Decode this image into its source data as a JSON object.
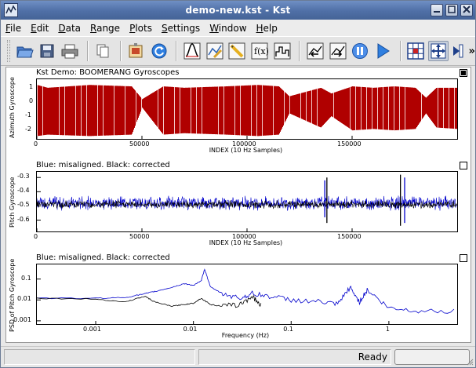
{
  "window": {
    "title": "demo-new.kst - Kst",
    "controls": [
      "minimize-icon",
      "maximize-icon",
      "close-icon"
    ],
    "titlebar_color": "#4f6fa6"
  },
  "menu": [
    {
      "label": "File",
      "mnemonic": "F"
    },
    {
      "label": "Edit",
      "mnemonic": "E"
    },
    {
      "label": "Data",
      "mnemonic": "D"
    },
    {
      "label": "Range",
      "mnemonic": "R"
    },
    {
      "label": "Plots",
      "mnemonic": "P"
    },
    {
      "label": "Settings",
      "mnemonic": "S"
    },
    {
      "label": "Window",
      "mnemonic": "W"
    },
    {
      "label": "Help",
      "mnemonic": "H"
    }
  ],
  "toolbar": {
    "icons": [
      "open-icon",
      "save-icon",
      "print-icon",
      "copy-icon",
      "export-image-icon",
      "reload-icon",
      "data-wizard-icon",
      "edit-curve-icon",
      "edit-plugin-icon",
      "edit-equation-icon",
      "edit-histogram-icon",
      "zoom-back-icon",
      "zoom-forward-icon",
      "pause-icon",
      "play-icon",
      "layout-grid-icon",
      "zoom-mode-icon",
      "more-icon"
    ],
    "active": "zoom-mode-icon",
    "overflow_label": "»"
  },
  "plots": [
    {
      "title": "Kst Demo: BOOMERANG Gyroscopes",
      "ylabel": "Azimuth Gyroscope",
      "xlabel": "INDEX (10 Hz Samples)",
      "y_ticks": [
        "1",
        "0",
        "-1",
        "-2"
      ],
      "x_ticks": [
        "0",
        "50000",
        "100000",
        "150000"
      ],
      "selected": true
    },
    {
      "title": "Blue: misaligned.  Black: corrected",
      "ylabel": "Pitch Gyroscope",
      "xlabel": "INDEX (10 Hz Samples)",
      "y_ticks": [
        "-0.3",
        "-0.4",
        "-0.5",
        "-0.6"
      ],
      "x_ticks": [
        "0",
        "50000",
        "100000",
        "150000"
      ],
      "selected": false
    },
    {
      "title": "Blue: misaligned.  Black: corrected",
      "ylabel": "PSD of Pitch Gyroscope",
      "xlabel": "Frequency (Hz)",
      "y_ticks": [
        "0.1",
        "0.01",
        "0.001"
      ],
      "x_ticks": [
        "0.001",
        "0.01",
        "0.1",
        "1"
      ],
      "selected": false
    }
  ],
  "chart_data": [
    {
      "type": "line",
      "title": "Kst Demo: BOOMERANG Gyroscopes",
      "xlabel": "INDEX (10 Hz Samples)",
      "ylabel": "Azimuth Gyroscope",
      "xlim": [
        0,
        200000
      ],
      "ylim": [
        -2.6,
        1.6
      ],
      "series": [
        {
          "name": "Azimuth",
          "color": "#b00000",
          "x": [
            0,
            5000,
            25000,
            45000,
            50000,
            60000,
            70000,
            90000,
            105000,
            115000,
            120000,
            135000,
            140000,
            150000,
            160000,
            170000,
            180000,
            185000,
            190000,
            200000
          ],
          "y_min": [
            -2.4,
            -2.3,
            -2.4,
            -2.3,
            -0.4,
            -2.3,
            -2.2,
            -2.3,
            -2.4,
            -2.3,
            -0.8,
            -1.8,
            -1.0,
            -2.0,
            -1.9,
            -2.0,
            -1.9,
            -0.8,
            -1.8,
            -1.9
          ],
          "y_max": [
            1.2,
            1.0,
            1.2,
            1.1,
            0.2,
            1.1,
            1.0,
            1.1,
            1.2,
            1.1,
            0.4,
            1.0,
            0.6,
            1.1,
            1.0,
            1.1,
            1.0,
            0.3,
            1.0,
            1.0
          ]
        }
      ]
    },
    {
      "type": "line",
      "title": "Blue: misaligned.  Black: corrected",
      "xlabel": "INDEX (10 Hz Samples)",
      "ylabel": "Pitch Gyroscope",
      "xlim": [
        0,
        200000
      ],
      "ylim": [
        -0.68,
        -0.26
      ],
      "series": [
        {
          "name": "misaligned",
          "color": "#0000cc",
          "center": -0.48,
          "spread": 0.035,
          "spikes": [
            {
              "x": 137000,
              "min": -0.58,
              "max": -0.32
            },
            {
              "x": 175000,
              "min": -0.62,
              "max": -0.3
            }
          ]
        },
        {
          "name": "corrected",
          "color": "#000000",
          "center": -0.49,
          "spread": 0.02,
          "spikes": [
            {
              "x": 138000,
              "min": -0.62,
              "max": -0.3
            },
            {
              "x": 173000,
              "min": -0.64,
              "max": -0.28
            }
          ]
        }
      ]
    },
    {
      "type": "line",
      "title": "Blue: misaligned.  Black: corrected",
      "xlabel": "Frequency (Hz)",
      "ylabel": "PSD of Pitch Gyroscope",
      "x_scale": "log",
      "y_scale": "log",
      "xlim": [
        0.00025,
        5
      ],
      "ylim": [
        0.0007,
        0.5
      ],
      "series": [
        {
          "name": "misaligned",
          "color": "#0000cc",
          "x": [
            0.00025,
            0.001,
            0.002,
            0.0032,
            0.004,
            0.006,
            0.008,
            0.01,
            0.012,
            0.013,
            0.015,
            0.02,
            0.03,
            0.04,
            0.06,
            0.1,
            0.2,
            0.3,
            0.4,
            0.5,
            0.6,
            1,
            2,
            5
          ],
          "y": [
            0.012,
            0.012,
            0.013,
            0.02,
            0.025,
            0.04,
            0.06,
            0.05,
            0.08,
            0.3,
            0.04,
            0.02,
            0.012,
            0.02,
            0.015,
            0.01,
            0.008,
            0.006,
            0.04,
            0.008,
            0.03,
            0.004,
            0.003,
            0.003
          ]
        },
        {
          "name": "corrected",
          "color": "#000000",
          "x": [
            0.00025,
            0.001,
            0.002,
            0.0032,
            0.004,
            0.006,
            0.008,
            0.01,
            0.012,
            0.015,
            0.02,
            0.03,
            0.04,
            0.05
          ],
          "y": [
            0.012,
            0.011,
            0.008,
            0.015,
            0.008,
            0.005,
            0.006,
            0.007,
            0.012,
            0.006,
            0.005,
            0.006,
            0.015,
            0.005
          ]
        }
      ]
    }
  ],
  "status": {
    "message": "Ready",
    "progress": 0
  }
}
